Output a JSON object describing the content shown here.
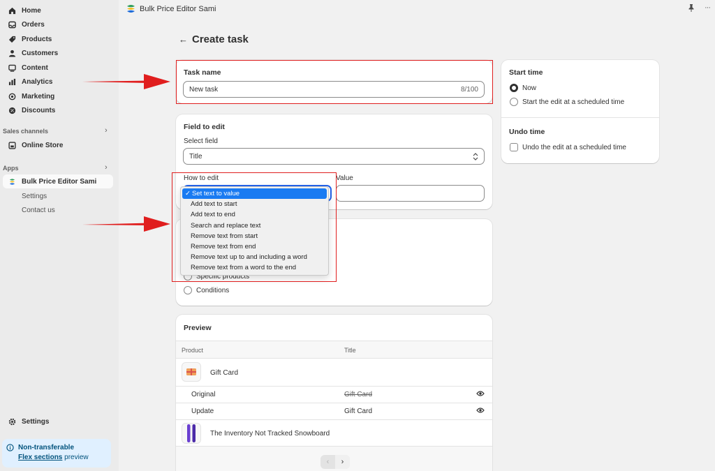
{
  "sidebar": {
    "items": [
      {
        "label": "Home",
        "icon": "home-icon"
      },
      {
        "label": "Orders",
        "icon": "inbox-icon"
      },
      {
        "label": "Products",
        "icon": "tag-icon"
      },
      {
        "label": "Customers",
        "icon": "person-icon"
      },
      {
        "label": "Content",
        "icon": "content-icon"
      },
      {
        "label": "Analytics",
        "icon": "bar-chart-icon"
      },
      {
        "label": "Marketing",
        "icon": "target-icon"
      },
      {
        "label": "Discounts",
        "icon": "discount-icon"
      }
    ],
    "sales_channels_label": "Sales channels",
    "online_store": "Online Store",
    "apps_label": "Apps",
    "app_name": "Bulk Price Editor Sami",
    "app_sub": [
      "Settings",
      "Contact us"
    ],
    "settings": "Settings",
    "notice": {
      "title": "Non-transferable",
      "link": "Flex sections",
      "rest": " preview"
    }
  },
  "topbar": {
    "app_title": "Bulk Price Editor Sami",
    "more": "···"
  },
  "page": {
    "back": "←",
    "title": "Create task"
  },
  "task_name": {
    "heading": "Task name",
    "value": "New task",
    "count": "8/100"
  },
  "field_to_edit": {
    "heading": "Field to edit",
    "select_label": "Select field",
    "select_value": "Title",
    "how_label": "How to edit",
    "value_label": "Value",
    "options": [
      "Set text to value",
      "Add text to start",
      "Add text to end",
      "Search and replace text",
      "Remove text from start",
      "Remove text from end",
      "Remove text up to and including a word",
      "Remove text from a word to the end"
    ],
    "selected_index": 0,
    "check": "✓"
  },
  "apply_to": {
    "specific": "Specific products",
    "conditions": "Conditions"
  },
  "preview": {
    "heading": "Preview",
    "col_product": "Product",
    "col_title": "Title",
    "products": [
      {
        "name": "Gift Card",
        "original_label": "Original",
        "original": "Gift Card",
        "update_label": "Update",
        "update": "Gift Card"
      },
      {
        "name": "The Inventory Not Tracked Snowboard"
      }
    ],
    "prev": "‹",
    "next": "›"
  },
  "start_time": {
    "heading": "Start time",
    "now": "Now",
    "scheduled": "Start the edit at a scheduled time",
    "selected": "now"
  },
  "undo_time": {
    "heading": "Undo time",
    "label": "Undo the edit at a scheduled time",
    "checked": false
  },
  "colors": {
    "annotation_red": "#e01e1e",
    "selected_blue": "#1a7bf2",
    "notice_bg": "#e0f0ff"
  }
}
